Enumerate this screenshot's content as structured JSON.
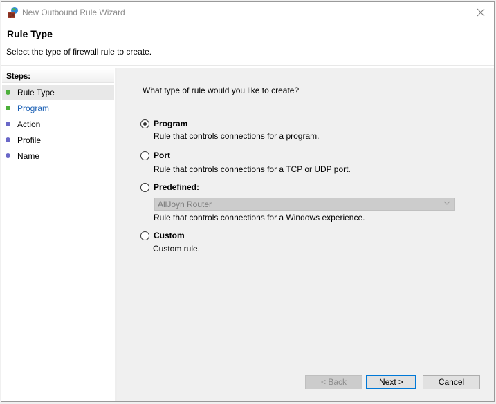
{
  "window": {
    "title": "New Outbound Rule Wizard",
    "icon": "firewall-globe-icon",
    "close_icon": "close-icon"
  },
  "header": {
    "title": "Rule Type",
    "subtitle": "Select the type of firewall rule to create."
  },
  "steps": {
    "heading": "Steps:",
    "items": [
      {
        "label": "Rule Type",
        "status": "current",
        "dot_color": "#4caf3a",
        "text_color": "#000000"
      },
      {
        "label": "Program",
        "status": "link",
        "dot_color": "#4caf3a",
        "text_color": "#1a5fb4"
      },
      {
        "label": "Action",
        "status": "pending",
        "dot_color": "#6a68c8",
        "text_color": "#000000"
      },
      {
        "label": "Profile",
        "status": "pending",
        "dot_color": "#6a68c8",
        "text_color": "#000000"
      },
      {
        "label": "Name",
        "status": "pending",
        "dot_color": "#6a68c8",
        "text_color": "#000000"
      }
    ]
  },
  "content": {
    "question": "What type of rule would you like to create?",
    "options": [
      {
        "label": "Program",
        "description": "Rule that controls connections for a program.",
        "checked": true
      },
      {
        "label": "Port",
        "description": "Rule that controls connections for a TCP or UDP port.",
        "checked": false
      },
      {
        "label": "Predefined:",
        "description": "Rule that controls connections for a Windows experience.",
        "checked": false
      },
      {
        "label": "Custom",
        "description": "Custom rule.",
        "checked": false
      }
    ],
    "predefined_select": {
      "value": "AllJoyn Router",
      "disabled": true
    }
  },
  "buttons": {
    "back": "< Back",
    "next": "Next >",
    "cancel": "Cancel"
  },
  "colors": {
    "accent": "#0078d7"
  }
}
